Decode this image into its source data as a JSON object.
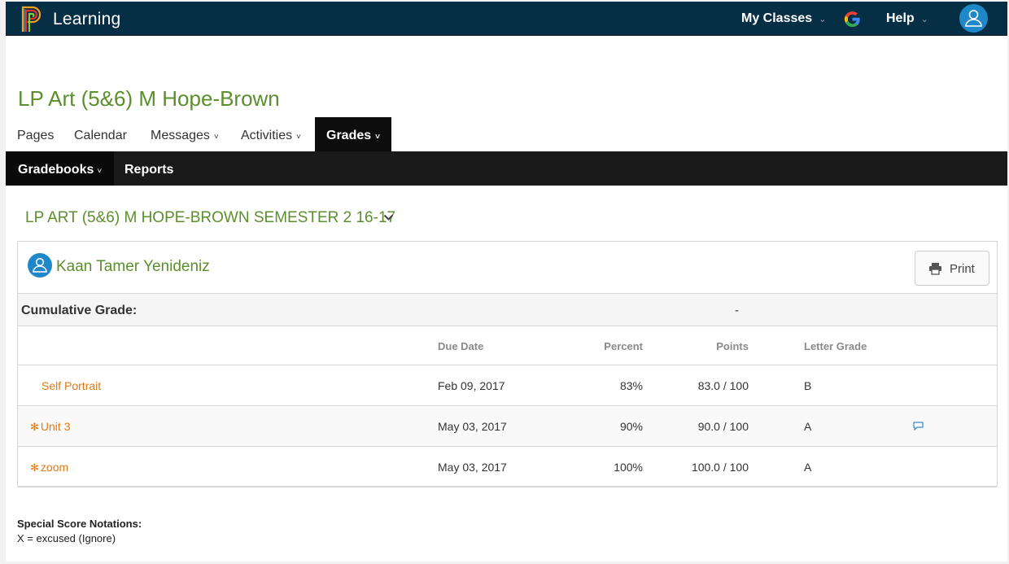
{
  "topbar": {
    "brand": "Learning",
    "my_classes": "My Classes",
    "help": "Help",
    "caret": "⌄"
  },
  "course": {
    "title": "LP Art (5&6) M Hope-Brown"
  },
  "tabs": [
    {
      "label": "Pages",
      "dropdown": false
    },
    {
      "label": "Calendar",
      "dropdown": false
    },
    {
      "label": "Messages",
      "dropdown": true
    },
    {
      "label": "Activities",
      "dropdown": true
    },
    {
      "label": "Grades",
      "dropdown": true,
      "active": true
    }
  ],
  "subnav": {
    "gradebooks": "Gradebooks",
    "reports": "Reports"
  },
  "gradebook": {
    "title": "LP ART (5&6) M HOPE-BROWN SEMESTER 2 16-17"
  },
  "student": {
    "name": "Kaan Tamer Yenideniz"
  },
  "print_label": "Print",
  "cumulative": {
    "label": "Cumulative Grade:",
    "value": "-"
  },
  "table": {
    "headers": {
      "due_date": "Due Date",
      "percent": "Percent",
      "points": "Points",
      "letter_grade": "Letter Grade"
    },
    "rows": [
      {
        "name": "Self Portrait",
        "due_date": "Feb 09, 2017",
        "percent": "83%",
        "points": "83.0 / 100",
        "letter": "B",
        "flagged": false,
        "comment": false
      },
      {
        "name": "Unit 3",
        "due_date": "May 03, 2017",
        "percent": "90%",
        "points": "90.0 / 100",
        "letter": "A",
        "flagged": true,
        "comment": true
      },
      {
        "name": "zoom",
        "due_date": "May 03, 2017",
        "percent": "100%",
        "points": "100.0 / 100",
        "letter": "A",
        "flagged": true,
        "comment": false
      }
    ]
  },
  "notations": {
    "title": "Special Score Notations:",
    "line1": "X = excused (Ignore)"
  },
  "colors": {
    "accent_green": "#5b8f2c",
    "header_navy": "#062e45",
    "assignment_orange": "#e07a18",
    "avatar_blue": "#1e88c8"
  }
}
